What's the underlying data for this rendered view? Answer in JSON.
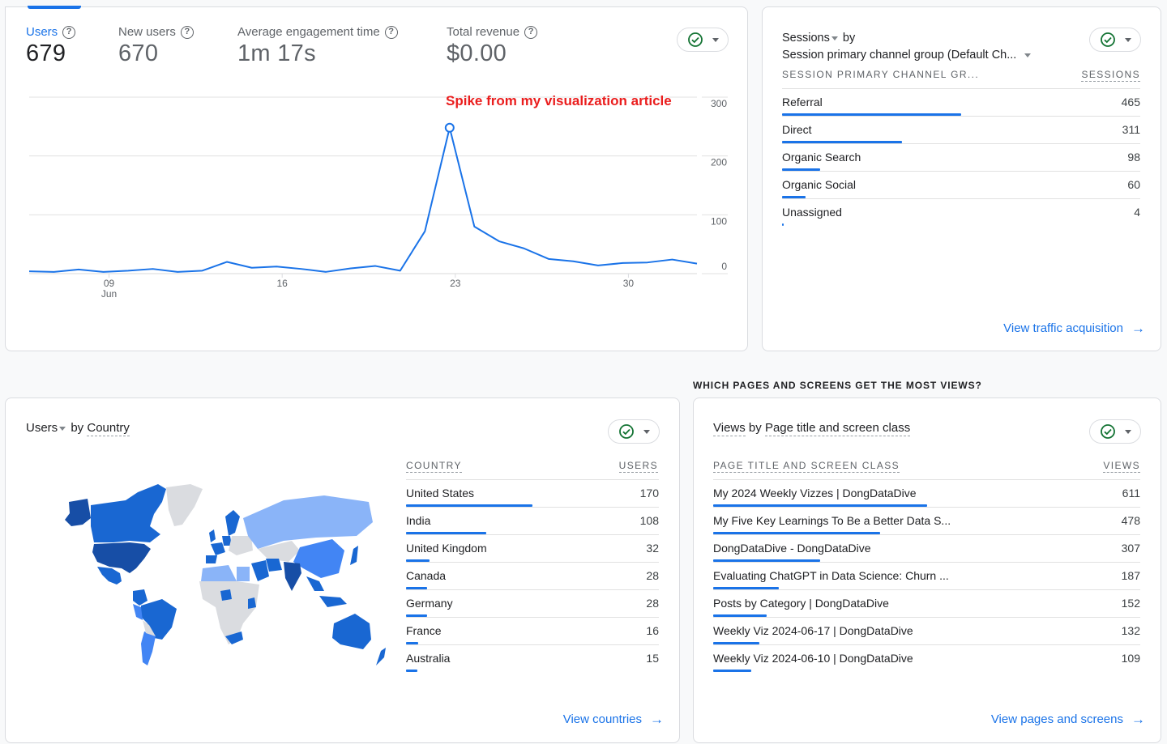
{
  "overview": {
    "metrics": [
      {
        "label": "Users",
        "value": "679",
        "active": true
      },
      {
        "label": "New users",
        "value": "670",
        "active": false
      },
      {
        "label": "Average engagement time",
        "value": "1m 17s",
        "active": false
      },
      {
        "label": "Total revenue",
        "value": "$0.00",
        "active": false
      }
    ],
    "help_icon": "?",
    "annotation": "Spike from my visualization article"
  },
  "chart_data": {
    "type": "line",
    "title": "Users",
    "series": [
      {
        "name": "Users",
        "values": [
          4,
          3,
          7,
          3,
          5,
          8,
          3,
          5,
          20,
          10,
          12,
          8,
          3,
          9,
          13,
          5,
          72,
          248,
          80,
          55,
          43,
          25,
          21,
          14,
          18,
          19,
          24,
          17
        ]
      }
    ],
    "x": [
      "Jun 6",
      "Jun 7",
      "Jun 8",
      "Jun 9",
      "Jun 10",
      "Jun 11",
      "Jun 12",
      "Jun 13",
      "Jun 14",
      "Jun 15",
      "Jun 16",
      "Jun 17",
      "Jun 18",
      "Jun 19",
      "Jun 20",
      "Jun 21",
      "Jun 22",
      "Jun 23",
      "Jun 24",
      "Jun 25",
      "Jun 26",
      "Jun 27",
      "Jun 28",
      "Jun 29",
      "Jun 30",
      "Jul 1",
      "Jul 2",
      "Jul 3"
    ],
    "x_ticks": [
      {
        "index": 3,
        "label": "09",
        "sublabel": "Jun"
      },
      {
        "index": 10,
        "label": "16",
        "sublabel": ""
      },
      {
        "index": 17,
        "label": "23",
        "sublabel": ""
      },
      {
        "index": 24,
        "label": "30",
        "sublabel": ""
      }
    ],
    "y_ticks": [
      0,
      100,
      200,
      300
    ],
    "ylim": [
      0,
      300
    ],
    "highlight_index": 17,
    "grid": true,
    "line_color": "#1a73e8",
    "xlabel": "",
    "ylabel": ""
  },
  "sessions": {
    "metric": "Sessions",
    "by": "by",
    "dimension": "Session primary channel group (Default Ch...",
    "col_dimension": "SESSION PRIMARY CHANNEL GR...",
    "col_metric": "SESSIONS",
    "rows": [
      {
        "label": "Referral",
        "value": "465",
        "share": 1.0
      },
      {
        "label": "Direct",
        "value": "311",
        "share": 0.669
      },
      {
        "label": "Organic Search",
        "value": "98",
        "share": 0.211
      },
      {
        "label": "Organic Social",
        "value": "60",
        "share": 0.129
      },
      {
        "label": "Unassigned",
        "value": "4",
        "share": 0.009
      }
    ],
    "link": "View traffic acquisition"
  },
  "country": {
    "metric": "Users",
    "by": "by",
    "dimension": "Country",
    "col_dimension": "COUNTRY",
    "col_metric": "USERS",
    "rows": [
      {
        "label": "United States",
        "value": "170",
        "share": 1.0
      },
      {
        "label": "India",
        "value": "108",
        "share": 0.635
      },
      {
        "label": "United Kingdom",
        "value": "32",
        "share": 0.188
      },
      {
        "label": "Canada",
        "value": "28",
        "share": 0.165
      },
      {
        "label": "Germany",
        "value": "28",
        "share": 0.165
      },
      {
        "label": "France",
        "value": "16",
        "share": 0.094
      },
      {
        "label": "Australia",
        "value": "15",
        "share": 0.088
      }
    ],
    "link": "View countries",
    "map_colors": {
      "high": "#174ea6",
      "mid": "#1967d2",
      "low": "#4285f4",
      "lowest": "#8ab4f8",
      "none": "#dadce0"
    }
  },
  "pages": {
    "section_heading": "WHICH PAGES AND SCREENS GET THE MOST VIEWS?",
    "metric": "Views",
    "by": "by",
    "dimension": "Page title and screen class",
    "col_dimension": "PAGE TITLE AND SCREEN CLASS",
    "col_metric": "VIEWS",
    "rows": [
      {
        "label": "My 2024 Weekly Vizzes | DongDataDive",
        "value": "611",
        "share": 1.0
      },
      {
        "label": "My Five Key Learnings To Be a Better Data S...",
        "value": "478",
        "share": 0.782
      },
      {
        "label": "DongDataDive - DongDataDive",
        "value": "307",
        "share": 0.502
      },
      {
        "label": "Evaluating ChatGPT in Data Science: Churn ...",
        "value": "187",
        "share": 0.306
      },
      {
        "label": "Posts by Category | DongDataDive",
        "value": "152",
        "share": 0.249
      },
      {
        "label": "Weekly Viz 2024-06-17 | DongDataDive",
        "value": "132",
        "share": 0.216
      },
      {
        "label": "Weekly Viz 2024-06-10 | DongDataDive",
        "value": "109",
        "share": 0.178
      }
    ],
    "link": "View pages and screens"
  },
  "colors": {
    "accent": "#1a73e8",
    "check": "#137333",
    "annotation": "#ea1d1d"
  }
}
